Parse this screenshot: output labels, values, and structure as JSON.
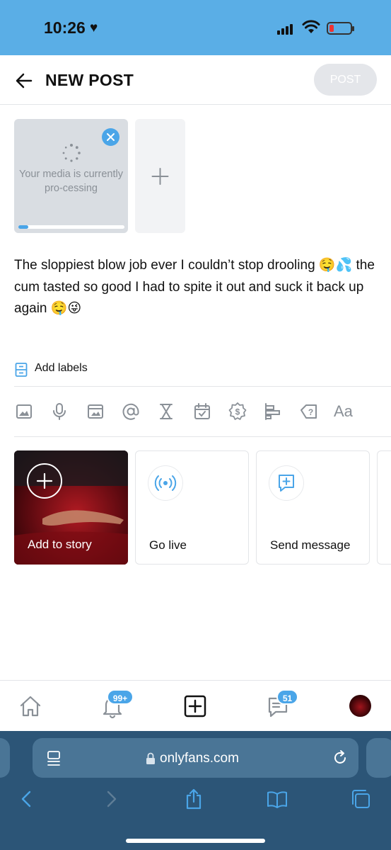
{
  "status": {
    "time": "10:26"
  },
  "header": {
    "title": "NEW POST",
    "post_label": "POST"
  },
  "media": {
    "processing_text": "Your media is currently pro-cessing",
    "progress": 0.09
  },
  "post": {
    "text": "The sloppiest blow job ever I couldn’t stop drooling 🤤💦 the cum tasted so good I had to spite it out and suck it back up again 🤤😜"
  },
  "labels": {
    "add_label": "Add labels"
  },
  "toolbar": {
    "items": [
      "image-icon",
      "microphone-icon",
      "vault-icon",
      "mention-icon",
      "hourglass-icon",
      "calendar-icon",
      "price-icon",
      "poll-icon",
      "quiz-icon",
      "text-format-icon"
    ],
    "text_format_label": "Aa"
  },
  "actions": {
    "story": "Add to story",
    "live": "Go live",
    "message": "Send message"
  },
  "nav": {
    "notifications_badge": "99+",
    "messages_badge": "51"
  },
  "browser": {
    "url": "onlyfans.com"
  },
  "colors": {
    "accent": "#4aa5e8",
    "status_bar": "#5aaee6",
    "browser_bg": "#2c5577"
  }
}
